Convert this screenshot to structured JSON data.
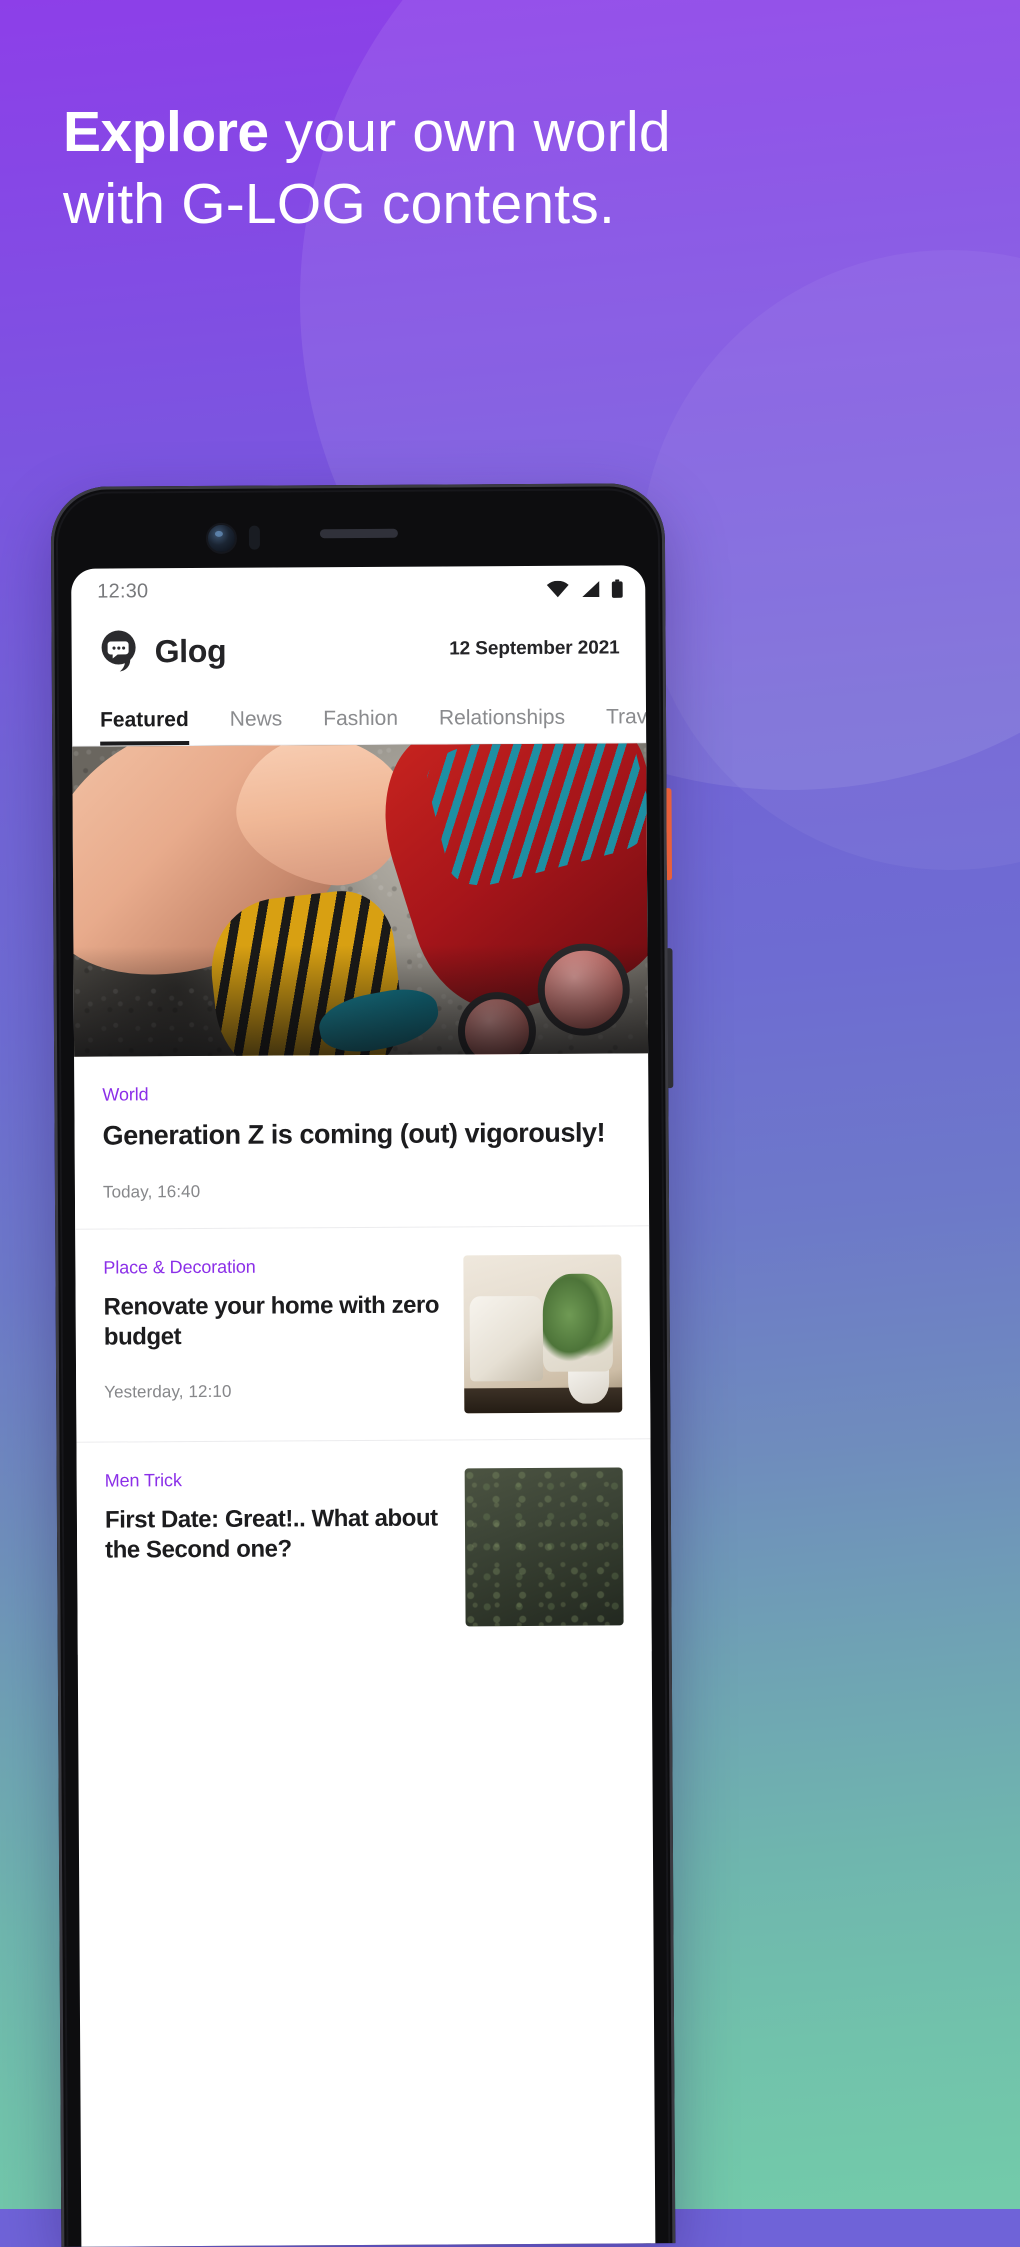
{
  "hero": {
    "headline_bold": "Explore",
    "headline_rest": " your own world with G-LOG contents."
  },
  "colors": {
    "accent_purple": "#8b2fe8",
    "bg_top": "#8d3fe8",
    "bg_bottom": "#73cbaa",
    "power_button": "#e8603a"
  },
  "phone": {
    "status_bar": {
      "time": "12:30",
      "icons": [
        "wifi-icon",
        "signal-icon",
        "battery-icon"
      ]
    },
    "app_header": {
      "logo_icon": "glog-speech-bubble-logo",
      "brand": "Glog",
      "date": "12 September 2021"
    },
    "tabs": [
      {
        "label": "Featured",
        "active": true
      },
      {
        "label": "News",
        "active": false
      },
      {
        "label": "Fashion",
        "active": false
      },
      {
        "label": "Relationships",
        "active": false
      },
      {
        "label": "Travel",
        "active": false
      }
    ],
    "hero_image_alt": "roller-skates-photo",
    "articles": [
      {
        "category": "World",
        "title": "Generation Z is coming (out) vigorously!",
        "time": "Today, 16:40",
        "has_thumb": false,
        "thumb_alt": ""
      },
      {
        "category": "Place & Decoration",
        "title": "Renovate your home with zero budget",
        "time": "Yesterday, 12:10",
        "has_thumb": true,
        "thumb_alt": "home-interior-thumbnail"
      },
      {
        "category": "Men Trick",
        "title": "First Date: Great!.. What about the Second one?",
        "time": "",
        "has_thumb": true,
        "thumb_alt": "outdoor-grass-thumbnail"
      }
    ]
  }
}
